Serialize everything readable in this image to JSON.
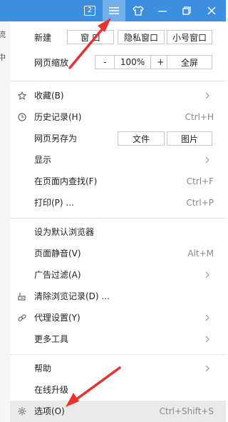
{
  "titlebar": {
    "tab_count": "2",
    "controls": [
      "tab-count",
      "menu",
      "skin",
      "minimize",
      "restore",
      "close"
    ]
  },
  "left_strip": [
    "流",
    "中"
  ],
  "new_row": {
    "label": "新建",
    "buttons": [
      "窗 口",
      "隐私窗口",
      "小号窗口"
    ]
  },
  "zoom_row": {
    "label": "网页缩放",
    "minus": "-",
    "value": "100%",
    "plus": "+",
    "fullscreen": "全屏"
  },
  "menu_items": [
    {
      "label": "收藏(B)",
      "icon": "star-icon",
      "shortcut": "",
      "arrow": true
    },
    {
      "label": "历史记录(H)",
      "icon": "clock-icon",
      "shortcut": "Ctrl+H",
      "arrow": false
    },
    {
      "label": "网页另存为",
      "icon": "",
      "shortcut": "",
      "arrow": false,
      "buttons": [
        "文件",
        "图片"
      ]
    },
    {
      "label": "显示",
      "icon": "",
      "shortcut": "",
      "arrow": true
    },
    {
      "label": "在页面内查找(F)",
      "icon": "",
      "shortcut": "Ctrl+F",
      "arrow": false
    },
    {
      "label": "打印(P) ...",
      "icon": "",
      "shortcut": "Ctrl+P",
      "arrow": false
    },
    {
      "label": "设为默认浏览器",
      "icon": "",
      "shortcut": "",
      "arrow": false
    },
    {
      "label": "页面静音(V)",
      "icon": "",
      "shortcut": "Alt+M",
      "arrow": false
    },
    {
      "label": "广告过滤(A)",
      "icon": "",
      "shortcut": "",
      "arrow": true
    },
    {
      "label": "清除浏览记录(D) ...",
      "icon": "eraser-icon",
      "shortcut": "",
      "arrow": false
    },
    {
      "label": "代理设置(Y)",
      "icon": "link-icon",
      "shortcut": "",
      "arrow": true
    },
    {
      "label": "更多工具",
      "icon": "",
      "shortcut": "",
      "arrow": true
    },
    {
      "label": "帮助",
      "icon": "",
      "shortcut": "",
      "arrow": true
    },
    {
      "label": "在线升级",
      "icon": "",
      "shortcut": "",
      "arrow": false
    },
    {
      "label": "选项(O)",
      "icon": "gear-icon",
      "shortcut": "Ctrl+Shift+S",
      "arrow": false
    }
  ],
  "colors": {
    "titlebar": "#3b8ee0",
    "annotation_arrow": "#e8322f",
    "hover_row": "#eaeaea"
  }
}
